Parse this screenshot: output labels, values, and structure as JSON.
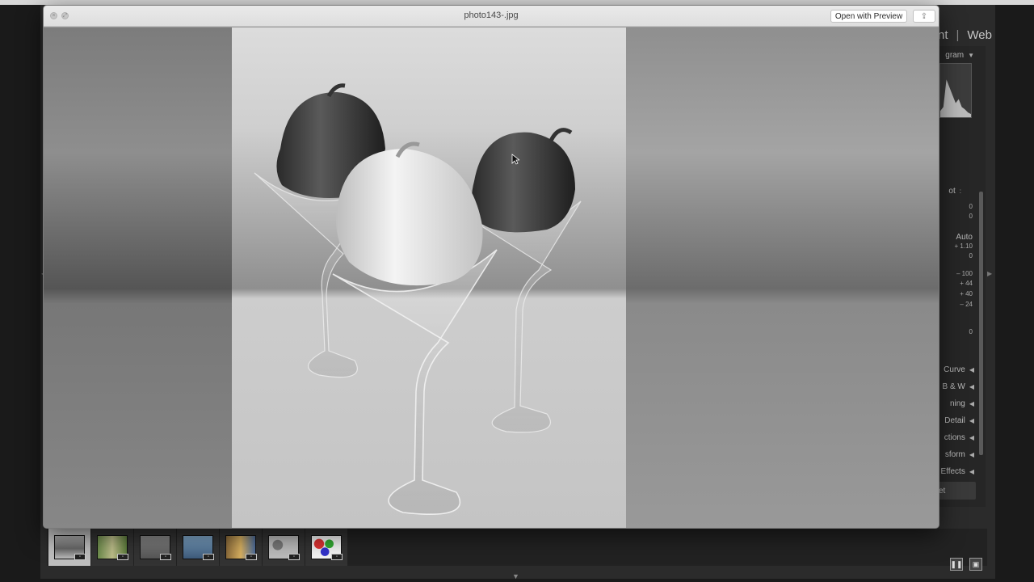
{
  "background_app": {
    "modules": [
      "nt",
      "Web"
    ],
    "right_panel": {
      "histogram_label": "gram",
      "sections": [
        "Curve",
        "B & W",
        "ning",
        "Detail",
        "ctions",
        "sform",
        "Effects"
      ],
      "auto_label": "Auto",
      "values": [
        "0",
        "0",
        "+ 1.10",
        "0",
        "– 100",
        "+ 44",
        "+ 40",
        "– 24",
        "0"
      ],
      "partial_label": "ot",
      "reset_label": "et"
    },
    "filmstrip_count": 7
  },
  "quicklook": {
    "title": "photo143-.jpg",
    "open_button": "Open with Preview",
    "share_icon": "share-icon"
  },
  "colors": {
    "titlebar": "#e4e4e4",
    "app_background": "#1a1a1a"
  }
}
